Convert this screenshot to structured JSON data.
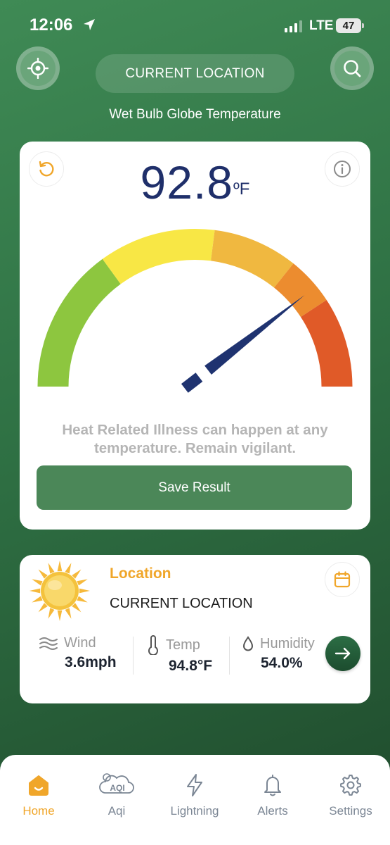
{
  "status_bar": {
    "time": "12:06",
    "network": "LTE",
    "battery": "47"
  },
  "header": {
    "location_button": "CURRENT LOCATION",
    "subtitle": "Wet Bulb Globe Temperature"
  },
  "gauge": {
    "value": "92.8",
    "unit": "ºF",
    "needle_fraction": 0.79,
    "segment_colors": [
      "#8dc63f",
      "#f8e745",
      "#f0b840",
      "#ec8c2f",
      "#e05a28"
    ],
    "note": "Heat Related Illness can happen at any temperature. Remain vigilant.",
    "save_label": "Save Result"
  },
  "location_card": {
    "label": "Location",
    "name": "CURRENT LOCATION",
    "metrics": [
      {
        "label": "Wind",
        "value": "3.6mph",
        "icon": "wind-icon"
      },
      {
        "label": "Temp",
        "value": "94.8°F",
        "icon": "thermometer-icon"
      },
      {
        "label": "Humidity",
        "value": "54.0%",
        "icon": "droplet-icon"
      }
    ]
  },
  "tabbar": {
    "items": [
      {
        "label": "Home",
        "icon": "home-icon",
        "active": true
      },
      {
        "label": "Aqi",
        "icon": "aqi-icon",
        "badge": "AQI"
      },
      {
        "label": "Lightning",
        "icon": "lightning-icon"
      },
      {
        "label": "Alerts",
        "icon": "bell-icon"
      },
      {
        "label": "Settings",
        "icon": "gear-icon"
      }
    ]
  },
  "colors": {
    "accent": "#f0a62a",
    "primary": "#4b8758",
    "value": "#1f2f6a"
  }
}
